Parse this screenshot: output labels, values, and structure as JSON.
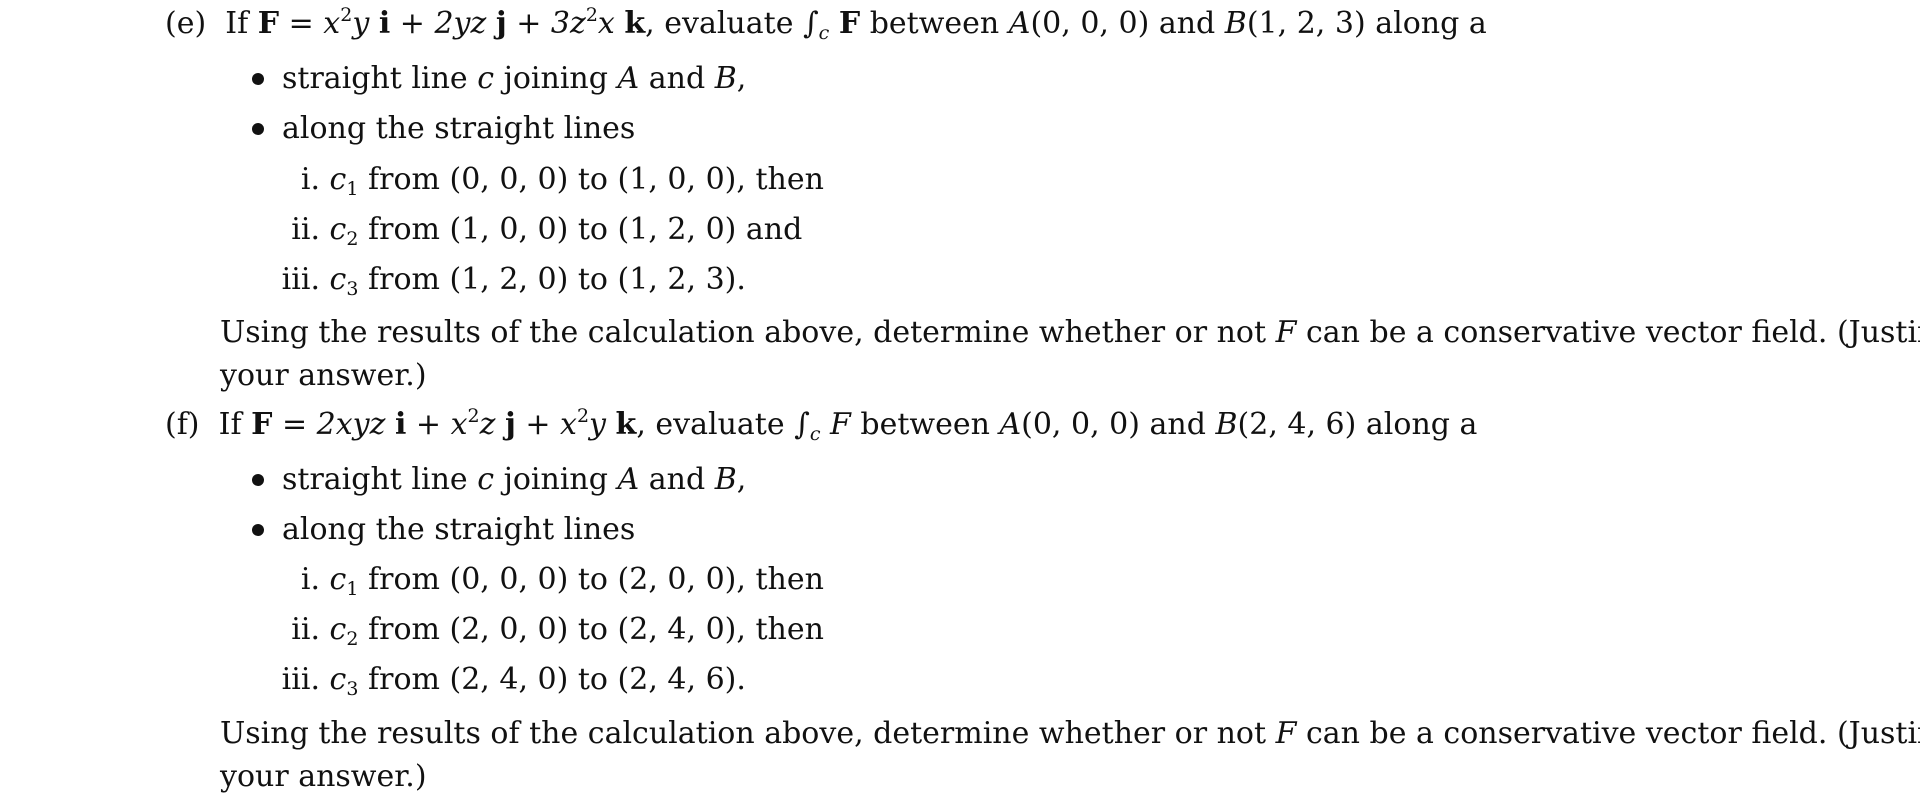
{
  "parts": [
    {
      "label": "(e)",
      "intro": "If",
      "field_symbol": "F",
      "field_symbol_bold": true,
      "field_terms": [
        {
          "coef": "x",
          "sup": "2",
          "rest": "y",
          "unit": "i"
        },
        {
          "coef": "2yz",
          "sup": "",
          "rest": "",
          "unit": "j"
        },
        {
          "coef": "3z",
          "sup": "2",
          "rest": "x",
          "unit": "k"
        }
      ],
      "evaluate_text": "evaluate",
      "integral_sub": "c",
      "integrand": "F",
      "between_text": "between",
      "point_a": {
        "name": "A",
        "coords": "(0, 0, 0)"
      },
      "and_text": "and",
      "point_b": {
        "name": "B",
        "coords": "(1, 2, 3)"
      },
      "along_text": "along a",
      "bullets": [
        {
          "text_before": "straight line",
          "var": "c",
          "text_mid": "joining",
          "a": "A",
          "and": "and",
          "b": "B",
          "end": ","
        },
        {
          "text": "along the straight lines"
        }
      ],
      "segments": [
        {
          "num": "i.",
          "curve": "c",
          "sub": "1",
          "from_text": "from",
          "from": "(0, 0, 0)",
          "to_text": "to",
          "to": "(1, 0, 0)",
          "tail": ", then"
        },
        {
          "num": "ii.",
          "curve": "c",
          "sub": "2",
          "from_text": "from",
          "from": "(1, 0, 0)",
          "to_text": "to",
          "to": "(1, 2, 0)",
          "tail": " and"
        },
        {
          "num": "iii.",
          "curve": "c",
          "sub": "3",
          "from_text": "from",
          "from": "(1, 2, 0)",
          "to_text": "to",
          "to": "(1, 2, 3)",
          "tail": "."
        }
      ],
      "conclusion_line1_a": "Using the results of the calculation above, determine whether or not",
      "conclusion_var": "F",
      "conclusion_line1_b": "can be a conservative vector field. (Justify",
      "conclusion_line2": "your answer.)"
    },
    {
      "label": "(f)",
      "intro": "If",
      "field_symbol": "F",
      "field_symbol_bold": true,
      "field_terms": [
        {
          "coef": "2xyz",
          "sup": "",
          "rest": "",
          "unit": "i"
        },
        {
          "coef": "x",
          "sup": "2",
          "rest": "z",
          "unit": "j"
        },
        {
          "coef": "x",
          "sup": "2",
          "rest": "y",
          "unit": "k"
        }
      ],
      "evaluate_text": "evaluate",
      "integral_sub": "c",
      "integrand": "F",
      "between_text": "between",
      "point_a": {
        "name": "A",
        "coords": "(0, 0, 0)"
      },
      "and_text": "and",
      "point_b": {
        "name": "B",
        "coords": "(2, 4, 6)"
      },
      "along_text": "along a",
      "bullets": [
        {
          "text_before": "straight line",
          "var": "c",
          "text_mid": "joining",
          "a": "A",
          "and": "and",
          "b": "B",
          "end": ","
        },
        {
          "text": "along the straight lines"
        }
      ],
      "segments": [
        {
          "num": "i.",
          "curve": "c",
          "sub": "1",
          "from_text": "from",
          "from": "(0, 0, 0)",
          "to_text": "to",
          "to": "(2, 0, 0)",
          "tail": ", then"
        },
        {
          "num": "ii.",
          "curve": "c",
          "sub": "2",
          "from_text": "from",
          "from": "(2, 0, 0)",
          "to_text": "to",
          "to": "(2, 4, 0)",
          "tail": ", then"
        },
        {
          "num": "iii.",
          "curve": "c",
          "sub": "3",
          "from_text": "from",
          "from": "(2, 4, 0)",
          "to_text": "to",
          "to": "(2, 4, 6)",
          "tail": "."
        }
      ],
      "conclusion_line1_a": "Using the results of the calculation above, determine whether or not",
      "conclusion_var": "F",
      "conclusion_line1_b": "can be a conservative vector field. (Justify",
      "conclusion_line2": "your answer.)"
    }
  ]
}
